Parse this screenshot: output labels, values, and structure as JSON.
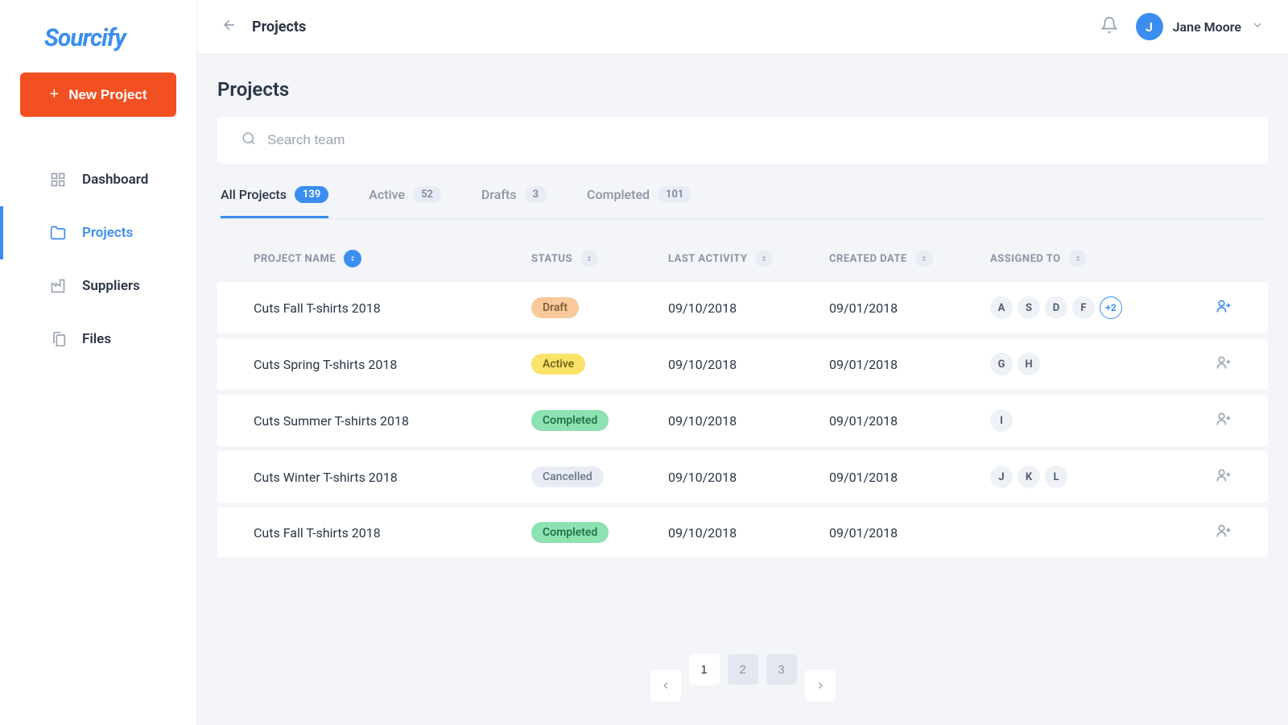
{
  "brand": "Sourcify",
  "new_project_label": "New Project",
  "sidebar": {
    "items": [
      {
        "label": "Dashboard",
        "icon": "grid"
      },
      {
        "label": "Projects",
        "icon": "folder",
        "active": true
      },
      {
        "label": "Suppliers",
        "icon": "factory"
      },
      {
        "label": "Files",
        "icon": "files"
      }
    ]
  },
  "header": {
    "breadcrumb": "Projects",
    "user_initial": "J",
    "user_name": "Jane Moore"
  },
  "page": {
    "title": "Projects",
    "search_placeholder": "Search team"
  },
  "tabs": [
    {
      "label": "All Projects",
      "count": "139",
      "active": true
    },
    {
      "label": "Active",
      "count": "52"
    },
    {
      "label": "Drafts",
      "count": "3"
    },
    {
      "label": "Completed",
      "count": "101"
    }
  ],
  "columns": {
    "name": "PROJECT NAME",
    "status": "STATUS",
    "activity": "LAST ACTIVITY",
    "created": "CREATED DATE",
    "assigned": "ASSIGNED TO"
  },
  "rows": [
    {
      "name": "Cuts Fall T-shirts 2018",
      "status": "Draft",
      "status_class": "status-draft",
      "activity": "09/10/2018",
      "created": "09/01/2018",
      "assignees": [
        "A",
        "S",
        "D",
        "F"
      ],
      "more": "+2",
      "highlight_add": true
    },
    {
      "name": "Cuts Spring T-shirts 2018",
      "status": "Active",
      "status_class": "status-active",
      "activity": "09/10/2018",
      "created": "09/01/2018",
      "assignees": [
        "G",
        "H"
      ]
    },
    {
      "name": "Cuts Summer T-shirts 2018",
      "status": "Completed",
      "status_class": "status-completed",
      "activity": "09/10/2018",
      "created": "09/01/2018",
      "assignees": [
        "I"
      ]
    },
    {
      "name": "Cuts Winter T-shirts 2018",
      "status": "Cancelled",
      "status_class": "status-cancelled",
      "activity": "09/10/2018",
      "created": "09/01/2018",
      "assignees": [
        "J",
        "K",
        "L"
      ]
    },
    {
      "name": "Cuts Fall T-shirts 2018",
      "status": "Completed",
      "status_class": "status-completed",
      "activity": "09/10/2018",
      "created": "09/01/2018",
      "assignees": []
    }
  ],
  "pagination": {
    "pages": [
      "1",
      "2",
      "3"
    ],
    "current": "1"
  }
}
